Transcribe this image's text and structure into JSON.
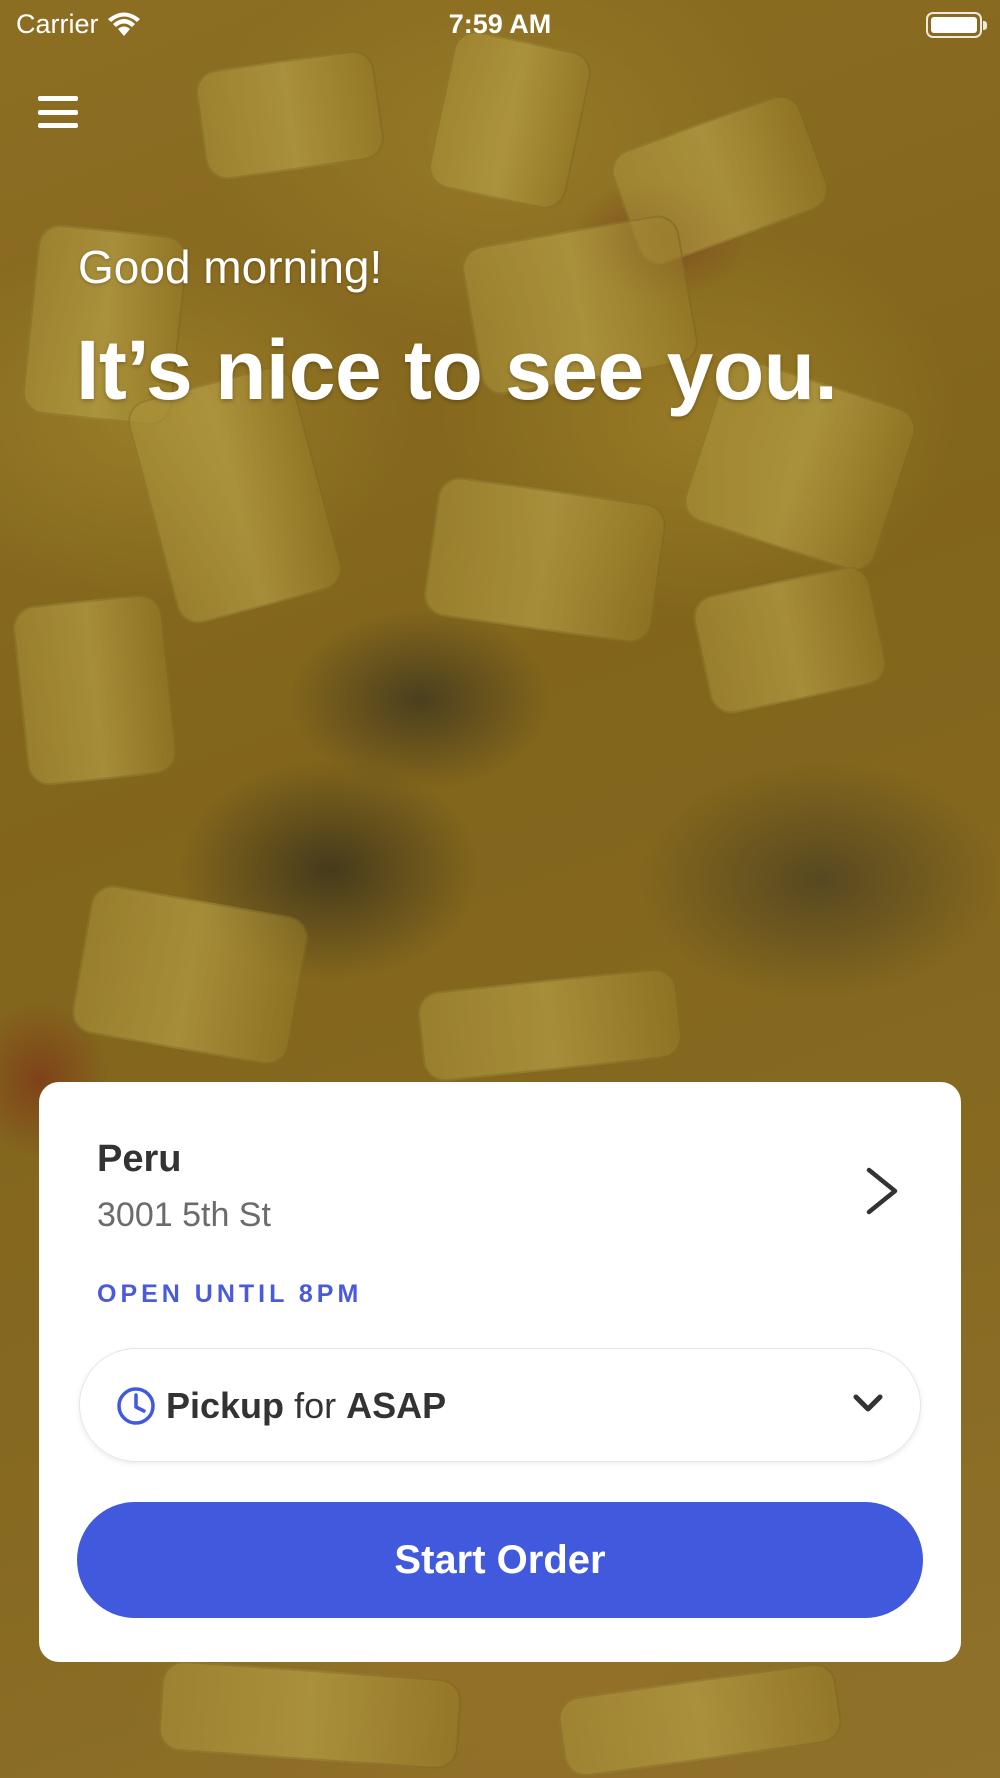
{
  "status_bar": {
    "carrier": "Carrier",
    "time": "7:59 AM"
  },
  "greeting": {
    "subtitle": "Good morning!",
    "title": "It’s nice to see you."
  },
  "store": {
    "name": "Peru",
    "address": "3001 5th St",
    "status": "OPEN UNTIL 8PM"
  },
  "order_mode": {
    "mode": "Pickup",
    "connector": "for",
    "time": "ASAP"
  },
  "actions": {
    "start_order": "Start Order"
  },
  "colors": {
    "accent": "#4159dc",
    "status_text": "#4a5ad9",
    "card_background": "#ffffff"
  },
  "icons": {
    "menu": "hamburger-icon",
    "store_link": "chevron-right-icon",
    "time": "clock-icon",
    "dropdown": "chevron-down-icon",
    "wifi": "wifi-icon",
    "battery": "battery-icon"
  }
}
